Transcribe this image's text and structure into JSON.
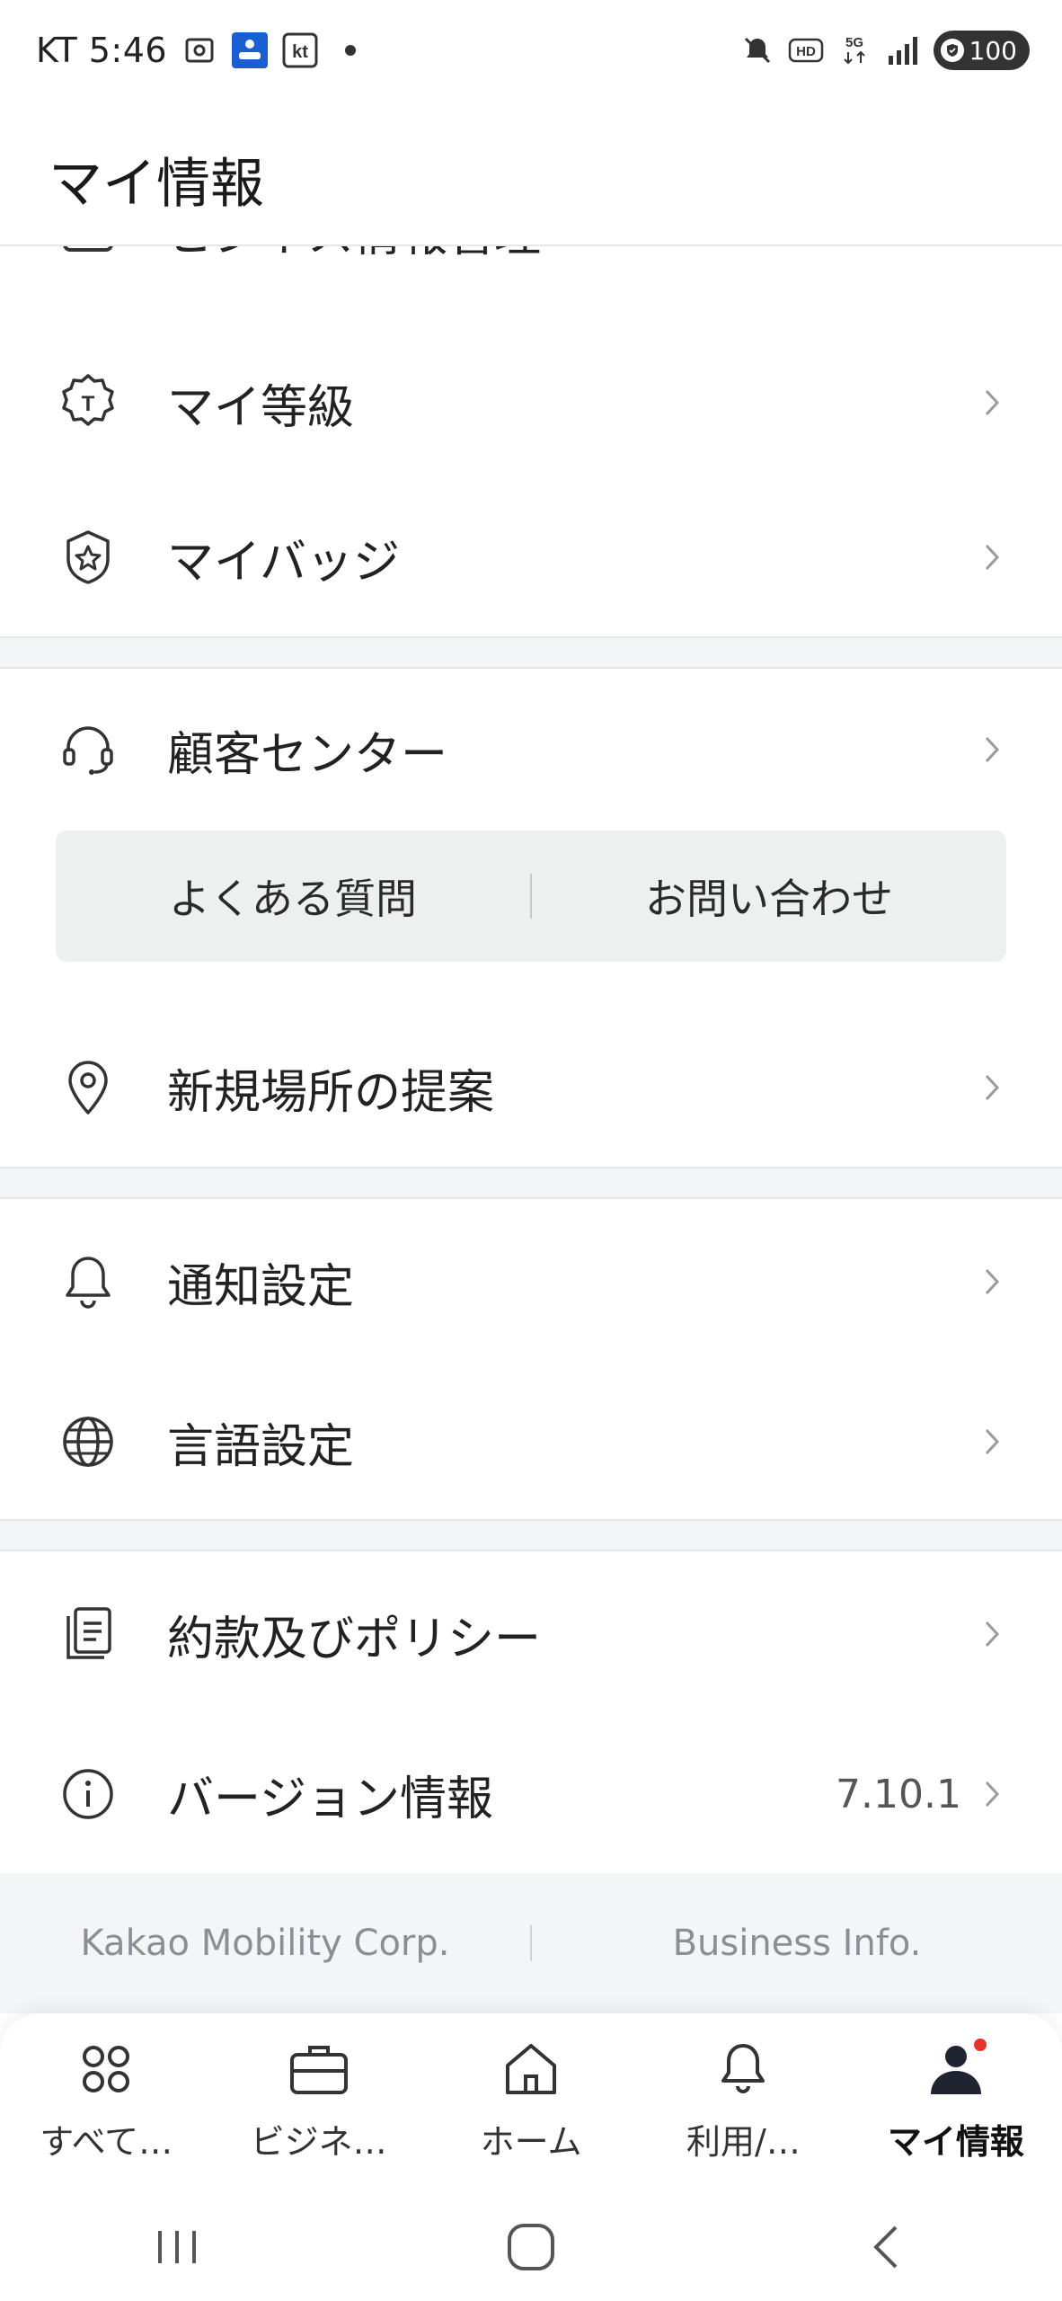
{
  "status_bar": {
    "time": "KT 5:46",
    "carrier_badge": "kt",
    "network": "5G",
    "hd": "HD",
    "battery": "100"
  },
  "header": {
    "title": "マイ情報"
  },
  "menu": {
    "partial_item": "ビジネス情報管理",
    "items": [
      {
        "label": "マイ等級",
        "icon": "grade-badge-icon"
      },
      {
        "label": "マイバッジ",
        "icon": "star-badge-icon"
      },
      {
        "label": "顧客センター",
        "icon": "headset-icon"
      },
      {
        "label": "新規場所の提案",
        "icon": "location-pin-icon"
      },
      {
        "label": "通知設定",
        "icon": "bell-icon"
      },
      {
        "label": "言語設定",
        "icon": "globe-icon"
      },
      {
        "label": "約款及びポリシー",
        "icon": "document-icon"
      },
      {
        "label": "バージョン情報",
        "icon": "info-icon",
        "value": "7.10.1"
      }
    ]
  },
  "customer_center": {
    "faq": "よくある質問",
    "contact": "お問い合わせ"
  },
  "footer": {
    "company": "Kakao Mobility Corp.",
    "business_info": "Business Info."
  },
  "bottom_nav": [
    {
      "label": "すべて…",
      "icon": "grid-icon"
    },
    {
      "label": "ビジネ…",
      "icon": "briefcase-icon"
    },
    {
      "label": "ホーム",
      "icon": "home-icon"
    },
    {
      "label": "利用/…",
      "icon": "bell-icon"
    },
    {
      "label": "マイ情報",
      "icon": "person-icon",
      "active": true
    }
  ],
  "colors": {
    "accent_dot": "#e5322d",
    "divider_bg": "#f4f5f7"
  }
}
